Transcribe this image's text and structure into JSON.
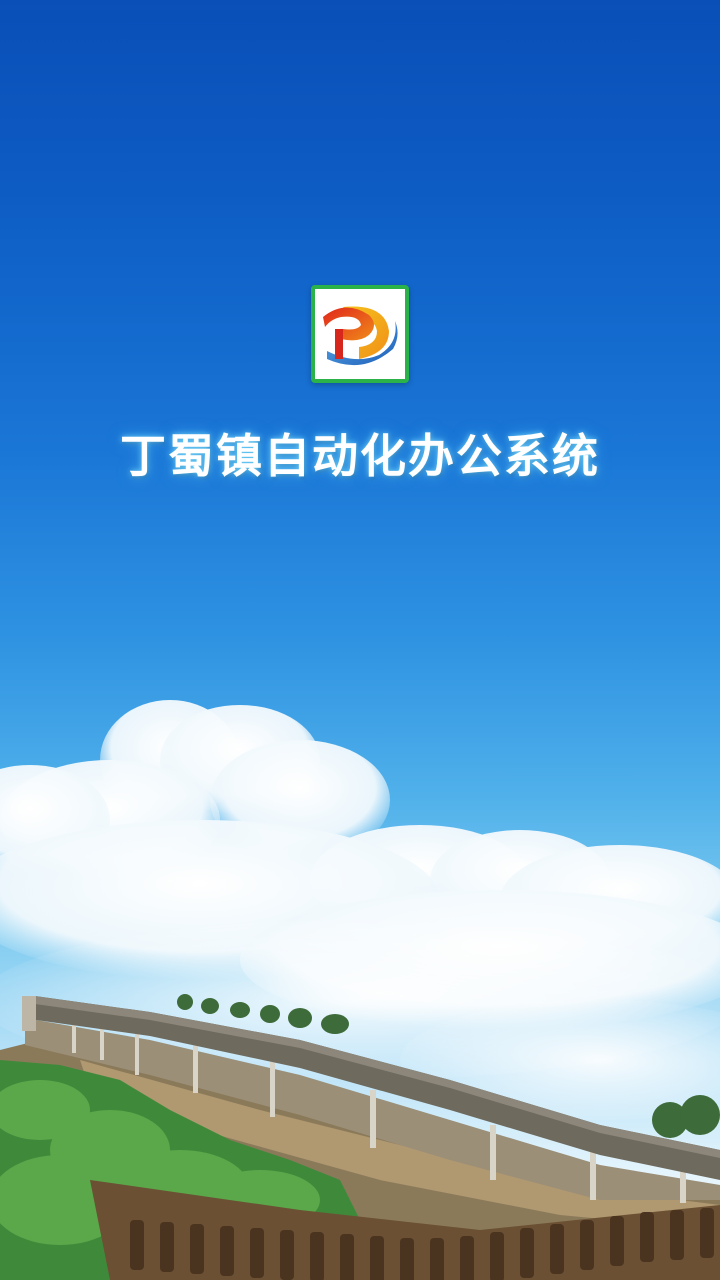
{
  "splash": {
    "app_icon": "dingshu-town-logo-icon",
    "title": "丁蜀镇自动化办公系统"
  },
  "colors": {
    "sky_top": "#0a4fb8",
    "sky_bottom": "#f4fbfe",
    "icon_border": "#2bb34a",
    "title_text": "#ffffff",
    "title_glow": "#5ac8ff"
  }
}
